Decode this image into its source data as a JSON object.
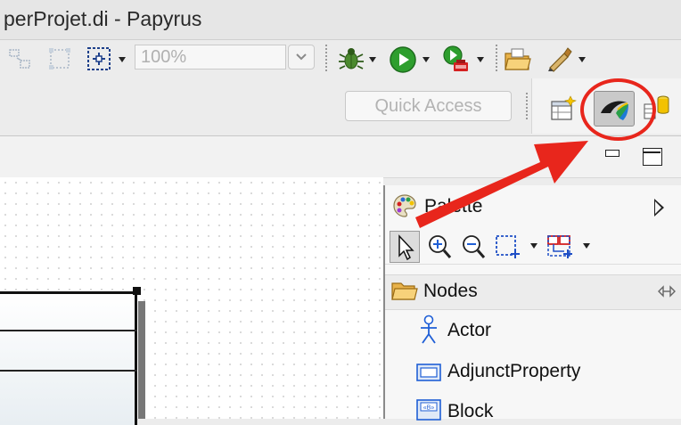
{
  "window": {
    "title": "perProjet.di - Papyrus"
  },
  "toolbar": {
    "zoom_value": "100%",
    "icons": [
      "align-icon",
      "layout-icon",
      "select-region-icon",
      "debug-bug-icon",
      "run-icon",
      "external-tools-icon",
      "open-folder-icon",
      "pen-tool-icon"
    ]
  },
  "quick_access": {
    "placeholder": "Quick Access"
  },
  "perspectives": {
    "items": [
      "open-perspective-icon",
      "papyrus-perspective-icon",
      "database-perspective-icon"
    ],
    "active": "papyrus-perspective-icon"
  },
  "palette": {
    "title": "Palette",
    "drawer": {
      "label": "Nodes"
    },
    "items": [
      {
        "label": "Actor",
        "icon": "actor-icon"
      },
      {
        "label": "AdjunctProperty",
        "icon": "adjunct-property-icon"
      },
      {
        "label": "Block",
        "icon": "block-icon"
      }
    ]
  },
  "annotation": {
    "color": "#e8261c"
  }
}
